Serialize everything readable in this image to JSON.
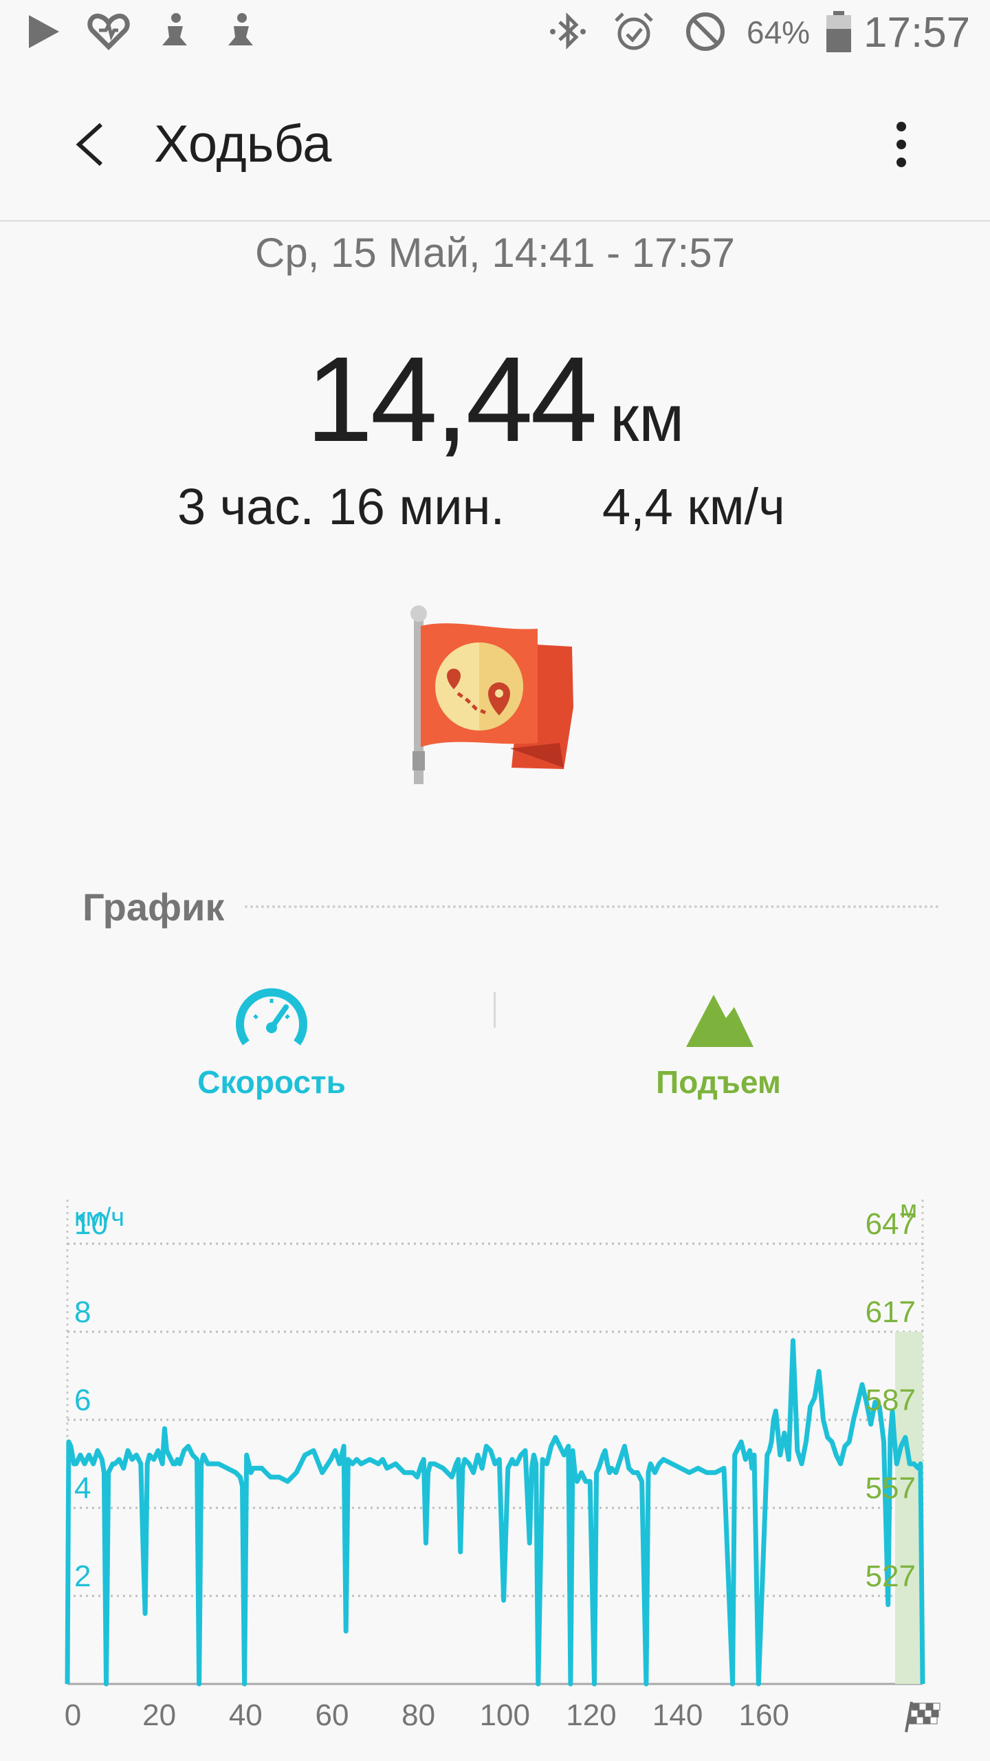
{
  "status_bar": {
    "battery": "64%",
    "time": "17:57",
    "icons": [
      "play-store-icon",
      "health-icon",
      "fitness-figure-icon",
      "fitness-figure-icon",
      "bluetooth-icon",
      "alarm-icon",
      "do-not-disturb-icon",
      "battery-icon"
    ]
  },
  "app_bar": {
    "title": "Ходьба",
    "icons": [
      "back-arrow-icon",
      "more-vert-icon"
    ]
  },
  "summary": {
    "date_range": "Ср, 15 Май, 14:41 - 17:57",
    "distance": "14,44",
    "distance_unit": "км",
    "duration": "3 час. 16 мин.",
    "avg_speed": "4,4 км/ч",
    "badge_icon": "route-flag-icon"
  },
  "graph": {
    "heading": "График",
    "tabs": [
      {
        "label": "Скорость",
        "icon": "speedometer-icon",
        "color": "#1ec0d8"
      },
      {
        "label": "Подъем",
        "icon": "mountain-icon",
        "color": "#7db33c"
      }
    ]
  },
  "colors": {
    "speed": "#1ec0d8",
    "elevation": "#7db33c",
    "elevation_fill": "#d9ead0",
    "text_secondary": "#757575"
  },
  "chart_data": {
    "type": "line",
    "xlabel": "",
    "ylabel_left": "км/ч",
    "ylabel_right": "м",
    "x_ticks": [
      0,
      20,
      40,
      60,
      80,
      100,
      120,
      140,
      160
    ],
    "x_end_icon": "finish-flag-icon",
    "xlim": [
      0,
      198
    ],
    "ylim_left": [
      0,
      11
    ],
    "left_ticks": [
      2,
      4,
      6,
      8,
      10
    ],
    "right_ticks": [
      527,
      557,
      587,
      617,
      647
    ],
    "grid": true,
    "series": [
      {
        "axis": "left",
        "x": [
          0,
          0.3,
          0.8,
          1.5,
          2,
          3,
          4,
          5,
          6,
          7,
          8,
          8.5,
          9,
          9.5,
          10,
          10.5,
          11,
          12,
          13,
          14,
          15,
          16,
          17,
          17.5,
          18,
          18.5,
          19,
          20,
          21,
          22,
          22.5,
          23,
          24,
          24.5,
          25,
          25.5,
          26,
          27,
          28,
          29,
          30,
          30.5,
          31,
          31.5,
          32,
          32.5,
          33,
          35,
          37,
          39,
          40,
          40.5,
          41,
          41.5,
          42,
          42.5,
          43,
          45,
          47,
          49,
          51,
          53,
          55,
          57,
          59,
          61,
          62,
          63,
          63.5,
          64,
          64.5,
          65,
          66,
          67,
          68,
          70,
          72,
          73,
          74,
          76,
          78,
          80,
          81,
          82,
          82.5,
          83,
          83.5,
          84,
          85,
          87,
          89,
          90,
          90.5,
          91,
          91.5,
          92,
          93,
          94,
          95,
          96,
          97,
          98,
          99,
          100,
          101,
          102,
          102.5,
          103,
          103.5,
          104,
          105,
          106,
          107,
          107.5,
          108,
          108.5,
          109,
          110,
          111,
          112,
          113,
          114,
          115,
          116,
          116.5,
          117,
          117.5,
          118,
          119,
          120,
          121,
          122,
          122.5,
          123,
          124,
          124.5,
          125,
          125.5,
          126,
          127,
          128,
          129,
          130,
          131,
          132,
          133,
          134,
          134.5,
          135,
          135.5,
          136,
          137,
          138,
          140,
          142,
          144,
          146,
          148,
          150,
          152,
          154,
          154.5,
          155,
          155.5,
          156,
          157,
          158,
          158.5,
          159,
          160,
          162,
          162.5,
          163,
          163.5,
          164,
          165,
          166,
          167,
          168,
          169,
          170,
          171,
          172,
          173,
          174,
          175,
          176,
          177,
          178,
          179,
          180,
          181,
          182,
          183,
          184,
          185,
          186,
          187,
          188,
          189,
          190,
          190.5,
          191,
          191.5,
          192,
          193,
          194,
          195,
          196,
          197,
          197.5,
          198
        ],
        "y": [
          0,
          5.5,
          5.4,
          5.0,
          5.0,
          5.2,
          5.0,
          5.2,
          5.0,
          5.3,
          5.1,
          4.8,
          0,
          4.8,
          4.9,
          5.0,
          5.0,
          5.1,
          4.9,
          5.3,
          5.1,
          5.2,
          5.0,
          3.2,
          1.6,
          5.0,
          5.2,
          5.1,
          5.3,
          5.0,
          5.8,
          5.3,
          5.1,
          5.0,
          5.0,
          5.1,
          5.0,
          5.3,
          5.4,
          5.2,
          5.1,
          0,
          5.0,
          5.2,
          5.1,
          5.0,
          5.0,
          5.0,
          4.9,
          4.8,
          4.7,
          4.5,
          0,
          5.2,
          5.0,
          4.8,
          4.9,
          4.9,
          4.7,
          4.7,
          4.6,
          4.8,
          5.2,
          5.3,
          4.8,
          5.1,
          5.3,
          5.0,
          5.2,
          5.4,
          1.2,
          5.1,
          5.0,
          5.1,
          5.0,
          5.1,
          5.0,
          5.1,
          4.9,
          5.0,
          4.8,
          4.8,
          4.7,
          5.0,
          5.1,
          3.2,
          4.8,
          5.0,
          5.0,
          4.9,
          4.7,
          5.0,
          5.1,
          3.0,
          4.9,
          5.1,
          5.0,
          4.8,
          5.2,
          4.9,
          5.4,
          5.3,
          5.0,
          5.1,
          1.9,
          4.9,
          5.0,
          5.1,
          5.0,
          5.0,
          5.2,
          5.3,
          3.2,
          4.9,
          5.2,
          5.0,
          0,
          5.1,
          5.0,
          5.4,
          5.6,
          5.4,
          5.2,
          5.4,
          0,
          5.3,
          4.8,
          4.6,
          4.8,
          4.6,
          4.6,
          0,
          4.8,
          4.9,
          5.2,
          5.3,
          5.0,
          4.8,
          4.9,
          4.8,
          5.1,
          5.4,
          4.9,
          4.8,
          4.8,
          4.6,
          0,
          4.8,
          5.0,
          4.9,
          4.8,
          5.0,
          5.1,
          5.0,
          4.9,
          4.8,
          4.9,
          4.8,
          4.8,
          4.9,
          0,
          5.2,
          5.3,
          5.4,
          5.5,
          5.1,
          5.3,
          4.9,
          5.2,
          0,
          5.2,
          5.3,
          5.5,
          6.0,
          6.2,
          5.2,
          5.7,
          5.1,
          7.8,
          5.3,
          5.0,
          5.5,
          6.3,
          6.5,
          7.1,
          6.0,
          5.6,
          5.5,
          5.2,
          5.0,
          5.4,
          5.5,
          6.0,
          6.4,
          6.8,
          6.4,
          5.9,
          6.4,
          6.3,
          5.5,
          1.8,
          5.6,
          6.2,
          5.5,
          5.0,
          5.4,
          5.6,
          5.0,
          5.0,
          4.9,
          5.0,
          0
        ]
      }
    ]
  }
}
